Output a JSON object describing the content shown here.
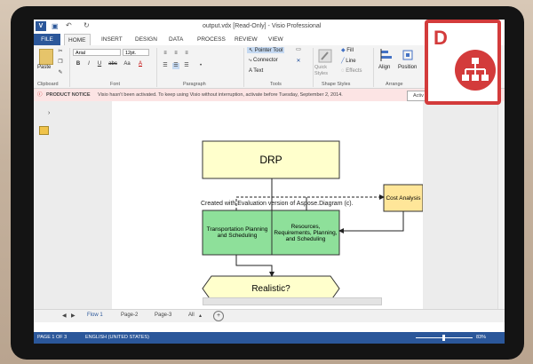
{
  "window": {
    "title": "output.vdx  [Read-Only] - Visio Professional"
  },
  "tabs": [
    "FILE",
    "HOME",
    "INSERT",
    "DESIGN",
    "DATA",
    "PROCESS",
    "REVIEW",
    "VIEW"
  ],
  "ribbon": {
    "clipboard": {
      "paste": "Paste",
      "label": "Clipboard"
    },
    "font": {
      "family": "Arial",
      "size": "12pt.",
      "label": "Font",
      "bold": "B",
      "italic": "I",
      "underline": "U",
      "strike": "abc",
      "case": "Aa",
      "color": "A"
    },
    "paragraph": {
      "label": "Paragraph"
    },
    "tools": {
      "pointer": "Pointer Tool",
      "connector": "Connector",
      "text": "Text",
      "label": "Tools"
    },
    "shape_styles": {
      "quick": "Quick Styles",
      "fill": "Fill",
      "line": "Line",
      "effects": "Effects",
      "label": "Shape Styles"
    },
    "arrange": {
      "align": "Align",
      "position": "Position",
      "label": "Arrange"
    }
  },
  "notice": {
    "title": "PRODUCT NOTICE",
    "text": "Visio hasn't been activated. To keep using Visio without interruption, activate before Tuesday, September 2, 2014.",
    "button": "Activ"
  },
  "diagram": {
    "drp": "DRP",
    "cost": "Cost Analysis",
    "transport": "Transportation Planning and Scheduling",
    "resources": "Resources, Requirements, Planning, and Scheduling",
    "realistic": "Realistic?",
    "watermark": "Created with Evaluation version of Aspose.Diagram (c)."
  },
  "pages": [
    "Flow 1",
    "Page-2",
    "Page-3",
    "All"
  ],
  "status": {
    "page": "PAGE 1 OF 3",
    "lang": "ENGLISH (UNITED STATES)",
    "zoom": "83%"
  },
  "badge": {
    "letter": "D"
  },
  "colors": {
    "accent": "#2b579a",
    "process_fill": "#8ee09a",
    "drp_fill": "#ffffcc",
    "cost_fill": "#ffe699",
    "badge": "#d33b3b"
  }
}
